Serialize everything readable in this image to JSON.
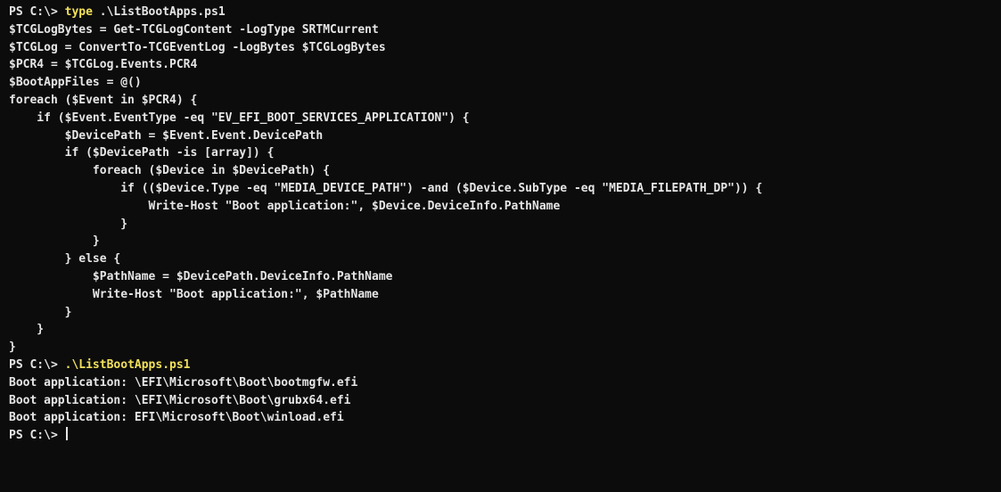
{
  "terminal": {
    "prompt": "PS C:\\> ",
    "lines": [
      {
        "prefix": "PS C:\\> ",
        "cmd": "type",
        "rest": " .\\ListBootApps.ps1"
      },
      {
        "text": "$TCGLogBytes = Get-TCGLogContent -LogType SRTMCurrent"
      },
      {
        "text": "$TCGLog = ConvertTo-TCGEventLog -LogBytes $TCGLogBytes"
      },
      {
        "text": "$PCR4 = $TCGLog.Events.PCR4"
      },
      {
        "text": "$BootAppFiles = @()"
      },
      {
        "text": "foreach ($Event in $PCR4) {"
      },
      {
        "text": "    if ($Event.EventType -eq \"EV_EFI_BOOT_SERVICES_APPLICATION\") {"
      },
      {
        "text": "        $DevicePath = $Event.Event.DevicePath"
      },
      {
        "text": "        if ($DevicePath -is [array]) {"
      },
      {
        "text": "            foreach ($Device in $DevicePath) {"
      },
      {
        "text": "                if (($Device.Type -eq \"MEDIA_DEVICE_PATH\") -and ($Device.SubType -eq \"MEDIA_FILEPATH_DP\")) {"
      },
      {
        "text": "                    Write-Host \"Boot application:\", $Device.DeviceInfo.PathName"
      },
      {
        "text": "                }"
      },
      {
        "text": "            }"
      },
      {
        "text": "        } else {"
      },
      {
        "text": "            $PathName = $DevicePath.DeviceInfo.PathName"
      },
      {
        "text": "            Write-Host \"Boot application:\", $PathName"
      },
      {
        "text": "        }"
      },
      {
        "text": "    }"
      },
      {
        "text": "}"
      },
      {
        "prefix": "PS C:\\> ",
        "cmd": ".\\ListBootApps.ps1",
        "rest": ""
      },
      {
        "text": "Boot application: \\EFI\\Microsoft\\Boot\\bootmgfw.efi"
      },
      {
        "text": "Boot application: \\EFI\\Microsoft\\Boot\\grubx64.efi"
      },
      {
        "text": "Boot application: EFI\\Microsoft\\Boot\\winload.efi"
      }
    ],
    "final_prompt": "PS C:\\> ",
    "colors": {
      "background": "#0c0c0c",
      "foreground": "#e6e6e6",
      "command": "#f1e05a"
    }
  }
}
